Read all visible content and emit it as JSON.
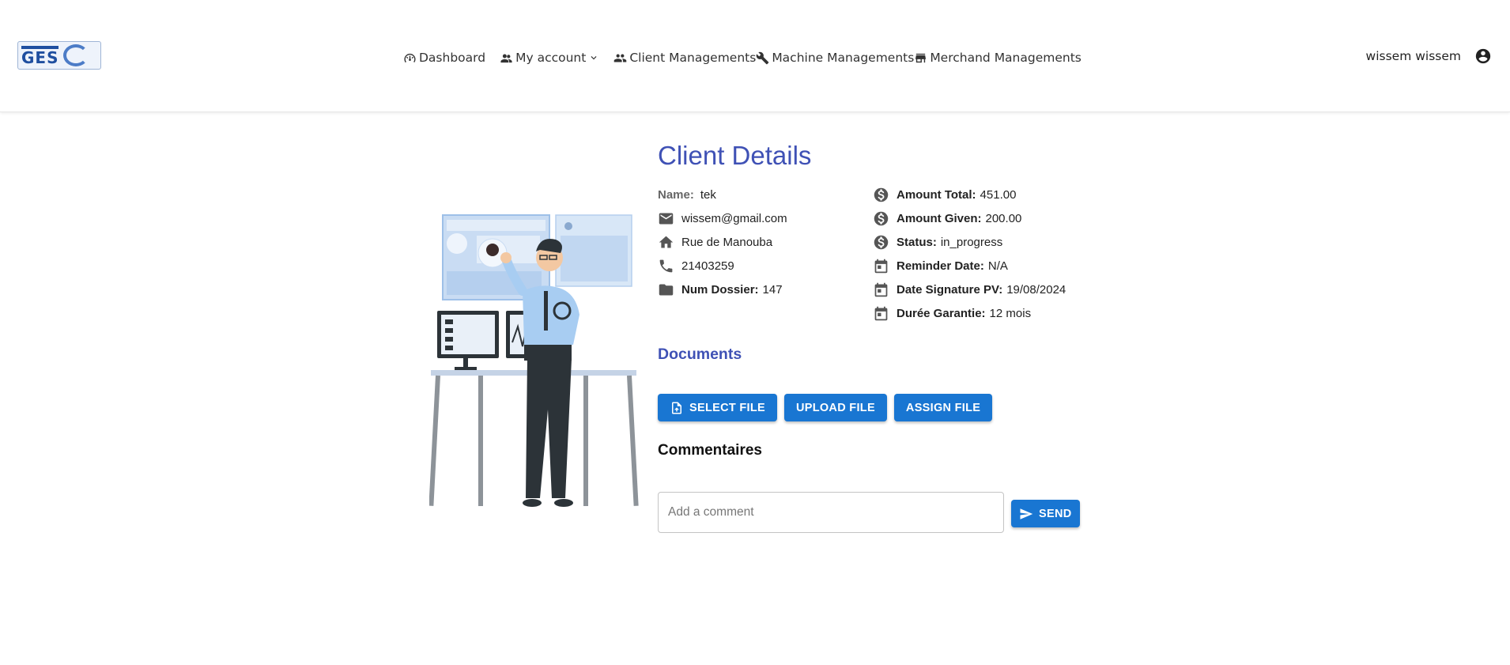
{
  "header": {
    "logo_text": "GES",
    "nav": [
      {
        "label": "Dashboard",
        "icon": "dashboard-icon"
      },
      {
        "label": "My account",
        "icon": "people-icon"
      },
      {
        "label": "Client Managements",
        "icon": "group-icon"
      },
      {
        "label": "Machine Managements",
        "icon": "wrench-icon"
      },
      {
        "label": "Merchand Managements",
        "icon": "store-icon"
      }
    ],
    "user_name": "wissem wissem",
    "user_icon": "account-circle-icon"
  },
  "client": {
    "title": "Client Details",
    "name_label": "Name:",
    "name": "tek",
    "email": "wissem@gmail.com",
    "address": "Rue de Manouba",
    "phone": "21403259",
    "num_dossier_label": "Num Dossier:",
    "num_dossier": "147",
    "amount_total_label": "Amount Total:",
    "amount_total": "451.00",
    "amount_given_label": "Amount Given:",
    "amount_given": "200.00",
    "status_label": "Status:",
    "status": "in_progress",
    "reminder_date_label": "Reminder Date:",
    "reminder_date": "N/A",
    "date_signature_label": "Date Signature PV:",
    "date_signature": "19/08/2024",
    "duree_garantie_label": "Durée Garantie:",
    "duree_garantie": "12 mois"
  },
  "documents": {
    "title": "Documents",
    "select_file": "SELECT FILE",
    "upload_file": "UPLOAD FILE",
    "assign_file": "ASSIGN FILE"
  },
  "comments": {
    "title": "Commentaires",
    "placeholder": "Add a comment",
    "send": "SEND"
  },
  "colors": {
    "primary": "#1976d2",
    "title": "#3f51b5"
  }
}
